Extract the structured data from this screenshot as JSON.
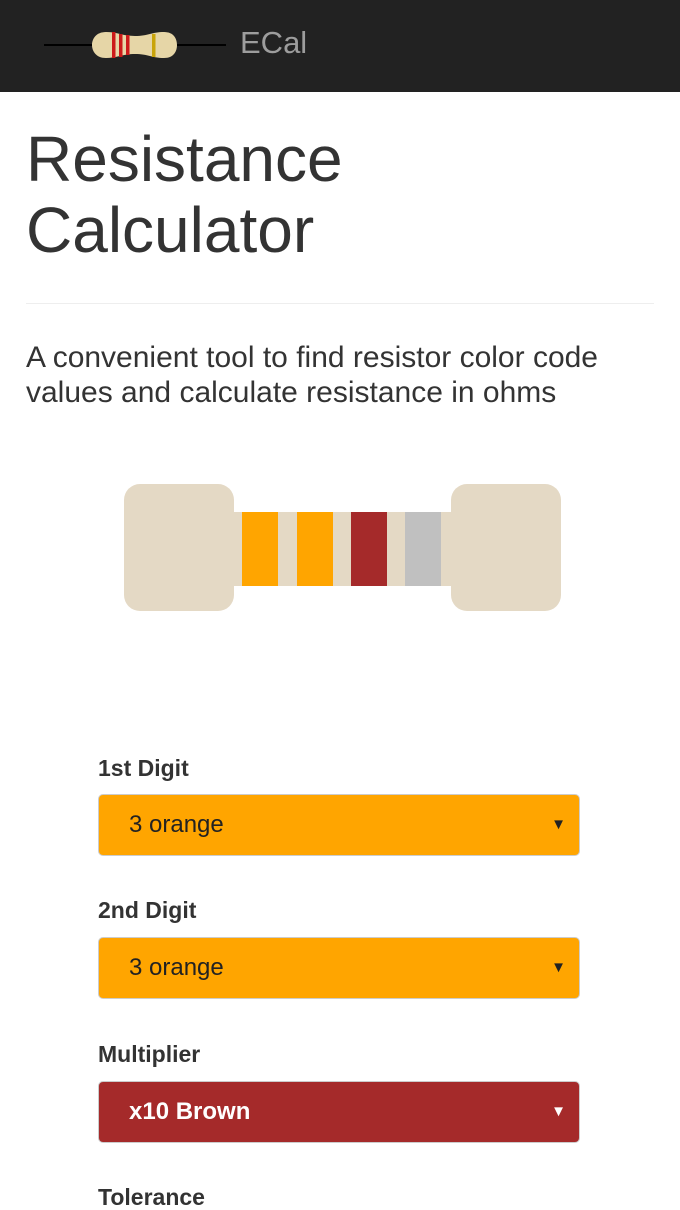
{
  "navbar": {
    "brand": "ECal",
    "logo_icon": "resistor-logo-icon"
  },
  "header": {
    "title_line1": "Resistance",
    "title_line2": "Calculator"
  },
  "lead": {
    "line1": "A convenient tool to find resistor color code",
    "line2": "values and calculate resistance in ohms"
  },
  "resistor_preview": {
    "body_color": "#e4d9c5",
    "band_colors": [
      "#ffa500",
      "#ffa500",
      "#a52a2a",
      "#c0c0c0"
    ]
  },
  "form": {
    "first_digit": {
      "label": "1st Digit",
      "value": "3 orange",
      "bg": "#ffa500",
      "text_color": "#222222"
    },
    "second_digit": {
      "label": "2nd Digit",
      "value": "3 orange",
      "bg": "#ffa500",
      "text_color": "#222222"
    },
    "multiplier": {
      "label": "Multiplier",
      "value": "x10 Brown",
      "bg": "#a52a2a",
      "text_color": "#ffffff"
    },
    "tolerance": {
      "label": "Tolerance"
    }
  },
  "icons": {
    "select_arrow": "▼"
  }
}
